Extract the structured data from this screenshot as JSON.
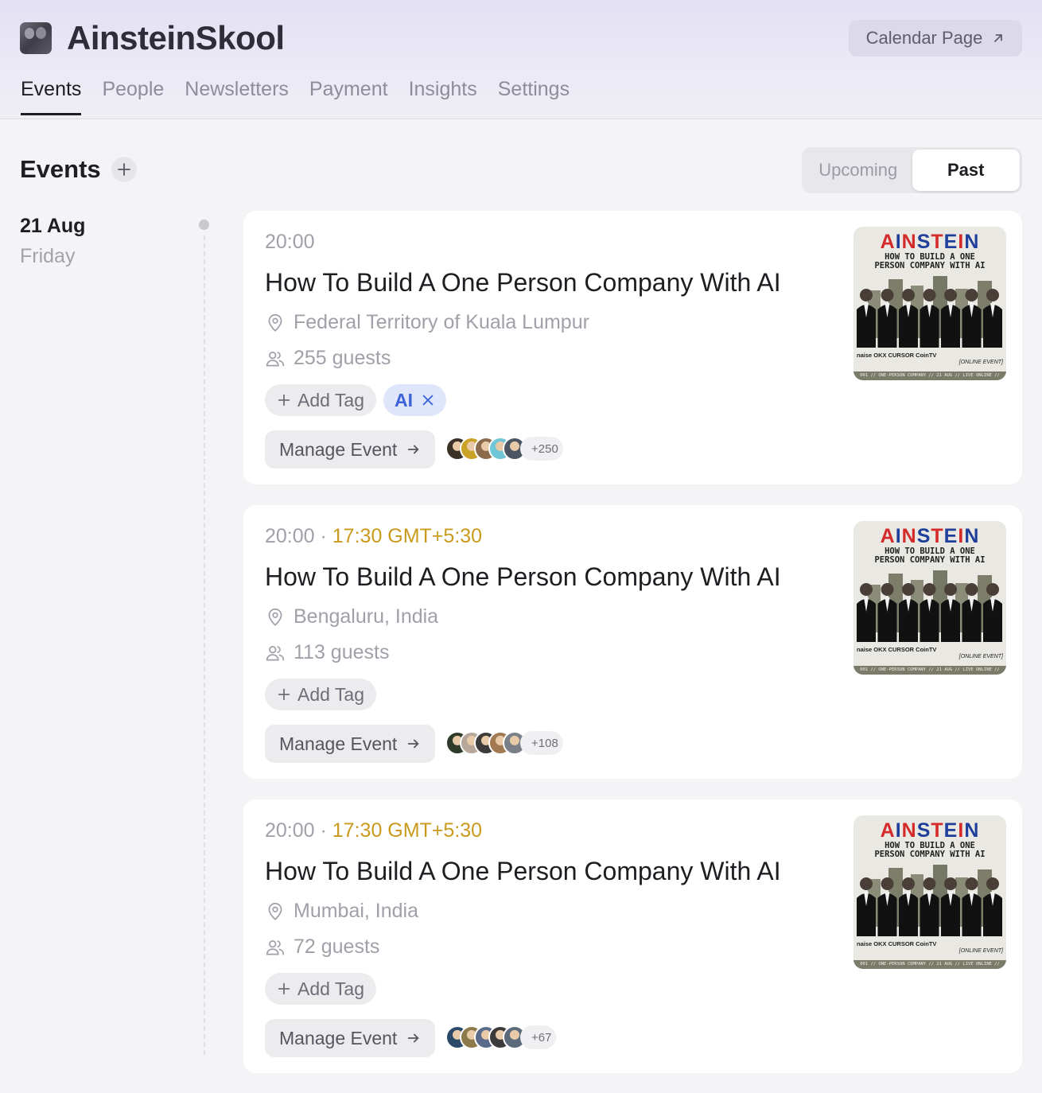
{
  "app": {
    "title": "AinsteinSkool",
    "calendar_button": "Calendar Page"
  },
  "nav": [
    "Events",
    "People",
    "Newsletters",
    "Payment",
    "Insights",
    "Settings"
  ],
  "nav_active": "Events",
  "section": {
    "title": "Events"
  },
  "segment": {
    "upcoming": "Upcoming",
    "past": "Past",
    "active": "Past"
  },
  "date": {
    "day": "21 Aug",
    "weekday": "Friday"
  },
  "events": [
    {
      "time": "20:00",
      "local_time": "",
      "title": "How To Build A One Person Company With AI",
      "location": "Federal Territory of Kuala Lumpur",
      "guests": "255 guests",
      "add_tag": "Add Tag",
      "tags": [
        "AI"
      ],
      "manage": "Manage Event",
      "extra_guests": "+250",
      "avatar_colors": [
        "#3a3226",
        "#c9a227",
        "#8a6a4a",
        "#6fc6d6",
        "#4b5563"
      ]
    },
    {
      "time": "20:00 · ",
      "local_time": "17:30 GMT+5:30",
      "title": "How To Build A One Person Company With AI",
      "location": "Bengaluru, India",
      "guests": "113 guests",
      "add_tag": "Add Tag",
      "tags": [],
      "manage": "Manage Event",
      "extra_guests": "+108",
      "avatar_colors": [
        "#2f3b2a",
        "#b7a69a",
        "#3d3a3a",
        "#a17a52",
        "#7a7f88"
      ]
    },
    {
      "time": "20:00 · ",
      "local_time": "17:30 GMT+5:30",
      "title": "How To Build A One Person Company With AI",
      "location": "Mumbai, India",
      "guests": "72 guests",
      "add_tag": "Add Tag",
      "tags": [],
      "manage": "Manage Event",
      "extra_guests": "+67",
      "avatar_colors": [
        "#2b4a6a",
        "#8d7a4a",
        "#5a6a8a",
        "#3b3b3b",
        "#5b6b7b"
      ]
    }
  ],
  "poster": {
    "brand_letters": [
      "A",
      "I",
      "N",
      "S",
      "T",
      "E",
      "I",
      "N"
    ],
    "subtitle_line1": "HOW TO BUILD A ONE",
    "subtitle_line2": "PERSON COMPANY WITH AI",
    "sponsors": "naise OKX CURSOR CoinTV",
    "online": "[ONLINE EVENT]",
    "footer": "001 // ONE-PERSON COMPANY // 21 AUG // LIVE ONLINE // FREE"
  },
  "colors": {
    "accent_tz": "#c99a1c",
    "tag_ai_bg": "#dfe6fb",
    "tag_ai_text": "#3b62d6"
  },
  "icons": {
    "location": "map-pin-icon",
    "guests": "users-icon",
    "plus": "plus-icon",
    "close": "close-icon",
    "arrow": "arrow-right-icon",
    "external": "arrow-up-right-icon"
  }
}
